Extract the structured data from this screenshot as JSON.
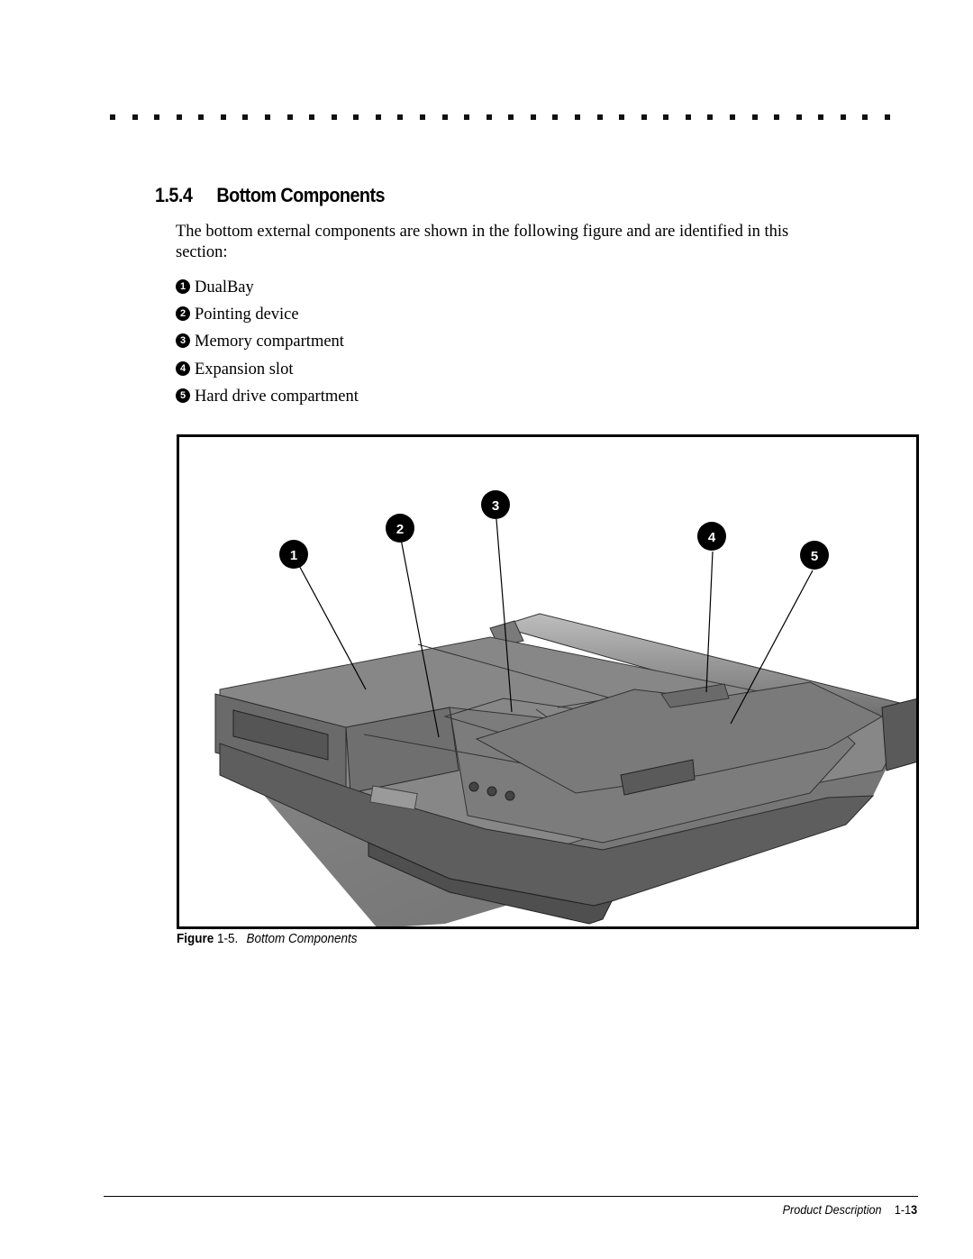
{
  "section": {
    "number": "1.5.4",
    "title": "Bottom Components"
  },
  "intro": "The bottom external components are shown in the following figure and are identified in this section:",
  "components": [
    {
      "number": "1",
      "label": "DualBay"
    },
    {
      "number": "2",
      "label": "Pointing device"
    },
    {
      "number": "3",
      "label": "Memory compartment"
    },
    {
      "number": "4",
      "label": "Expansion slot"
    },
    {
      "number": "5",
      "label": "Hard drive compartment"
    }
  ],
  "figure": {
    "label": "Figure",
    "number": "1-5.",
    "title": "Bottom Components",
    "image": "laptop-bottom-view-illustration"
  },
  "footer": {
    "section_name": "Product Description",
    "page_prefix": "1-1",
    "page_suffix": "3"
  }
}
